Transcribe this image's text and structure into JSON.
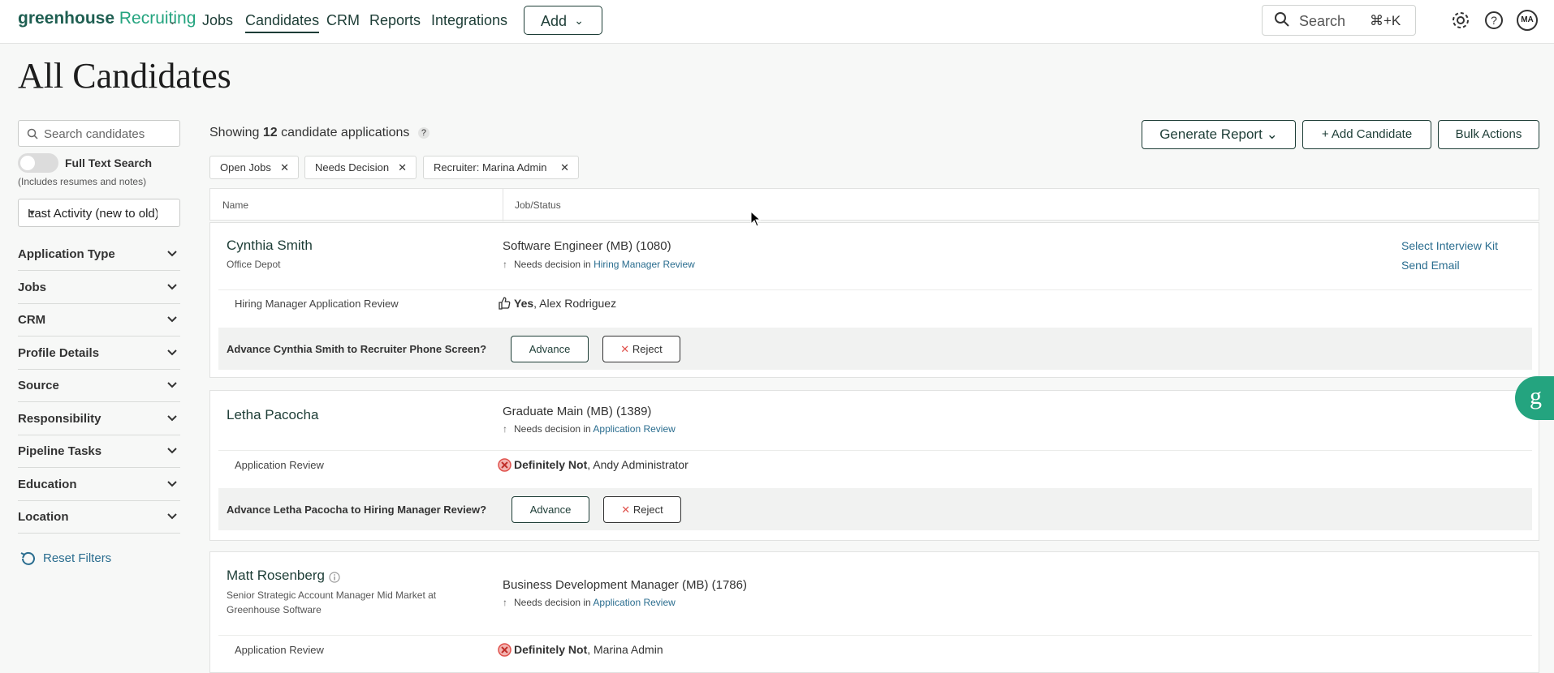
{
  "topnav": {
    "logo_main": "greenhouse",
    "logo_sub": "Recruiting",
    "links": [
      "Jobs",
      "Candidates",
      "CRM",
      "Reports",
      "Integrations"
    ],
    "add_label": "Add",
    "search_placeholder": "Search",
    "search_shortcut": "⌘+K",
    "avatar_initials": "MA"
  },
  "page": {
    "title": "All Candidates"
  },
  "sidebar": {
    "search_placeholder": "Search candidates",
    "full_text_title": "Full Text Search",
    "full_text_sub": "(Includes resumes and notes)",
    "sort_value": "Last Activity (new to old)",
    "facets": [
      "Application Type",
      "Jobs",
      "CRM",
      "Profile Details",
      "Source",
      "Responsibility",
      "Pipeline Tasks",
      "Education",
      "Location"
    ],
    "reset_label": "Reset Filters"
  },
  "results": {
    "showing_prefix": "Showing",
    "count": "12",
    "showing_suffix": "candidate applications",
    "help": "?",
    "generate_report": "Generate Report",
    "add_candidate": "Add Candidate",
    "bulk_actions": "Bulk Actions",
    "chips": [
      "Open Jobs",
      "Needs Decision",
      "Recruiter: Marina Admin"
    ],
    "col_name": "Name",
    "col_job": "Job/Status"
  },
  "candidates": [
    {
      "name": "Cynthia Smith",
      "sub": "Office Depot",
      "job": "Software Engineer (MB) (1080)",
      "status_prefix": "Needs decision in",
      "status_stage": "Hiring Manager Review",
      "stage": "Hiring Manager Application Review",
      "score": "Yes",
      "scorer": ", Alex Rodriguez",
      "advance_question": "Advance Cynthia Smith to Recruiter Phone Screen?",
      "advance": "Advance",
      "reject": "Reject",
      "link1": "Select Interview Kit",
      "link2": "Send Email"
    },
    {
      "name": "Letha Pacocha",
      "job": "Graduate Main (MB) (1389)",
      "status_prefix": "Needs decision in",
      "status_stage": "Application Review",
      "stage": "Application Review",
      "score": "Definitely Not",
      "scorer": ", Andy Administrator",
      "advance_question": "Advance Letha Pacocha to Hiring Manager Review?",
      "advance": "Advance",
      "reject": "Reject"
    },
    {
      "name": "Matt Rosenberg",
      "sub1": "Senior Strategic Account Manager Mid Market at",
      "sub2": "Greenhouse Software",
      "job": "Business Development Manager (MB) (1786)",
      "status_prefix": "Needs decision in",
      "status_stage": "Application Review",
      "stage": "Application Review",
      "score": "Definitely Not",
      "scorer": ", Marina Admin"
    }
  ],
  "colors": {
    "brand": "#24a47f",
    "nav_text": "#1d3d36",
    "link": "#2a6d8f",
    "reject_red": "#e0524d"
  }
}
